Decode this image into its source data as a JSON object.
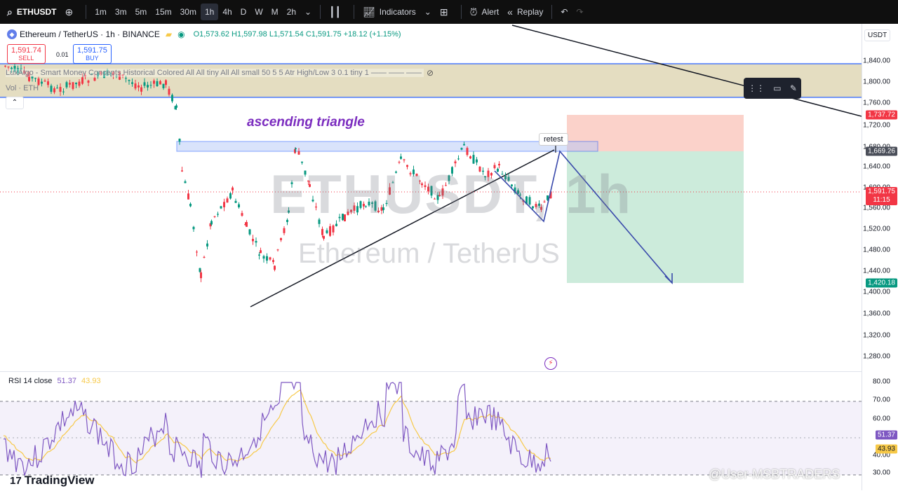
{
  "toolbar": {
    "symbol": "ETHUSDT",
    "intervals": [
      "1m",
      "3m",
      "5m",
      "15m",
      "30m",
      "1h",
      "4h",
      "D",
      "W",
      "M",
      "2h"
    ],
    "selected_interval": "1h",
    "indicators_label": "Indicators",
    "alert_label": "Alert",
    "replay_label": "Replay"
  },
  "legend": {
    "title": "Ethereum / TetherUS · 1h · BINANCE",
    "ohlc": "O1,573.62 H1,597.98 L1,571.54 C1,591.75 +18.12 (+1.15%)"
  },
  "trade": {
    "sell_price": "1,591.74",
    "sell_label": "SELL",
    "spread": "0.01",
    "buy_price": "1,591.75",
    "buy_label": "BUY"
  },
  "indicators": {
    "luxalgo": "LuxAlgo - Smart Money Concepts Historical Colored All All tiny All All small 50 5 5 Atr High/Low 3 0.1 tiny 1 —— —— ——",
    "vol": "Vol · ETH"
  },
  "annotations": {
    "pattern": "ascending triangle",
    "retest": "retest"
  },
  "watermark": {
    "symbol": "ETHUSDT, 1h",
    "name": "Ethereum / TetherUS"
  },
  "axis": {
    "currency": "USDT",
    "ticks": [
      "1,840.00",
      "1,800.00",
      "1,760.00",
      "1,720.00",
      "1,680.00",
      "1,640.00",
      "1,600.00",
      "1,560.00",
      "1,520.00",
      "1,480.00",
      "1,440.00",
      "1,400.00",
      "1,360.00",
      "1,320.00",
      "1,280.00"
    ],
    "tag_trendline": "1,737.72",
    "tag_resistance": "1,669.26",
    "tag_current": "1,591.75",
    "tag_timer": "11:15",
    "tag_target": "1,420.18"
  },
  "rsi": {
    "label": "RSI 14 close",
    "value1": "51.37",
    "value2": "43.93",
    "ticks": [
      "80.00",
      "70.00",
      "60.00",
      "40.00",
      "30.00"
    ]
  },
  "branding": {
    "logo": "TradingView",
    "credit": "@User-MSBTRADERS"
  },
  "colors": {
    "up": "#089981",
    "down": "#f23645",
    "accent": "#2962ff",
    "pattern_text": "#7b2cbf",
    "rsi_line": "#7e57c2",
    "rsi_ma": "#f7c948"
  }
}
